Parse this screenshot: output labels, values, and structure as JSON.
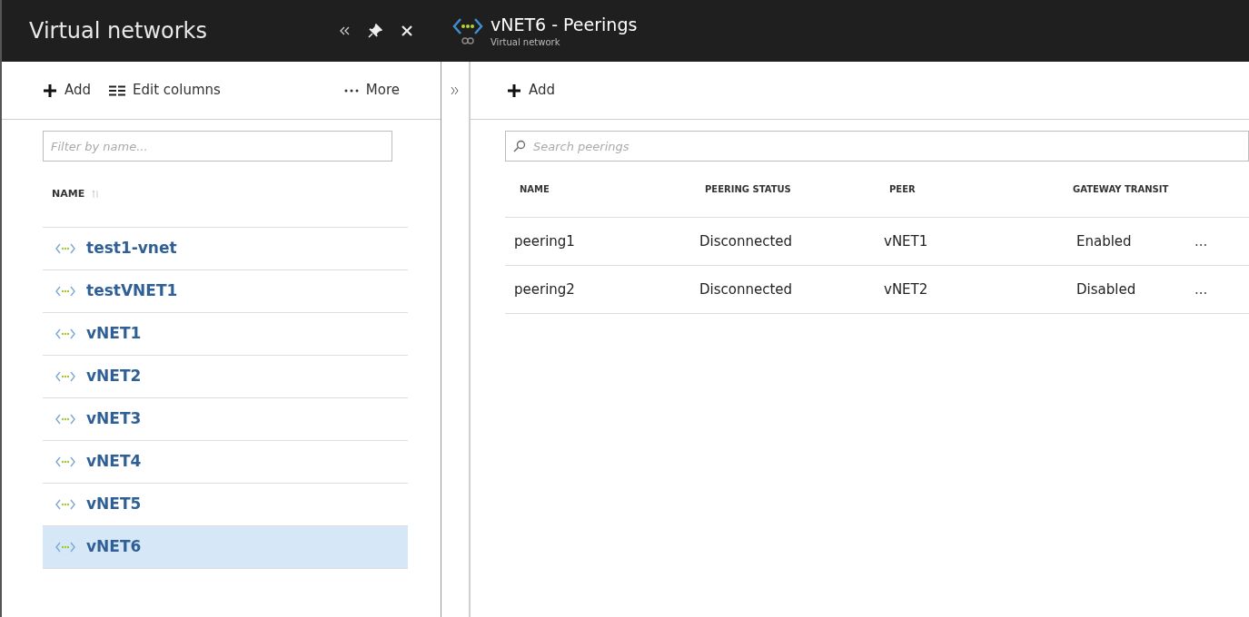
{
  "left_blade": {
    "title": "Virtual networks",
    "toolbar": [
      {
        "kind": "add",
        "label": "Add"
      },
      {
        "kind": "columns",
        "label": "Edit columns"
      },
      {
        "kind": "more",
        "label": "More"
      }
    ],
    "filter": {
      "placeholder": "Filter by name..."
    },
    "column": "NAME",
    "items": [
      {
        "name": "test1-vnet",
        "selected": false
      },
      {
        "name": "testVNET1",
        "selected": false
      },
      {
        "name": "vNET1",
        "selected": false
      },
      {
        "name": "vNET2",
        "selected": false
      },
      {
        "name": "vNET3",
        "selected": false
      },
      {
        "name": "vNET4",
        "selected": false
      },
      {
        "name": "vNET5",
        "selected": false
      },
      {
        "name": "vNET6",
        "selected": true
      }
    ]
  },
  "right_blade": {
    "title": "vNET6 - Peerings",
    "subtitle": "Virtual network",
    "toolbar": [
      {
        "kind": "add",
        "label": "Add"
      }
    ],
    "search": {
      "placeholder": "Search peerings"
    },
    "table": {
      "columns": [
        "NAME",
        "PEERING STATUS",
        "PEER",
        "GATEWAY TRANSIT"
      ],
      "rows": [
        {
          "cells": [
            "peering1",
            "Disconnected",
            "vNET1",
            "Enabled"
          ],
          "menu": "..."
        },
        {
          "cells": [
            "peering2",
            "Disconnected",
            "vNET2",
            "Disabled"
          ],
          "menu": "..."
        }
      ]
    }
  }
}
